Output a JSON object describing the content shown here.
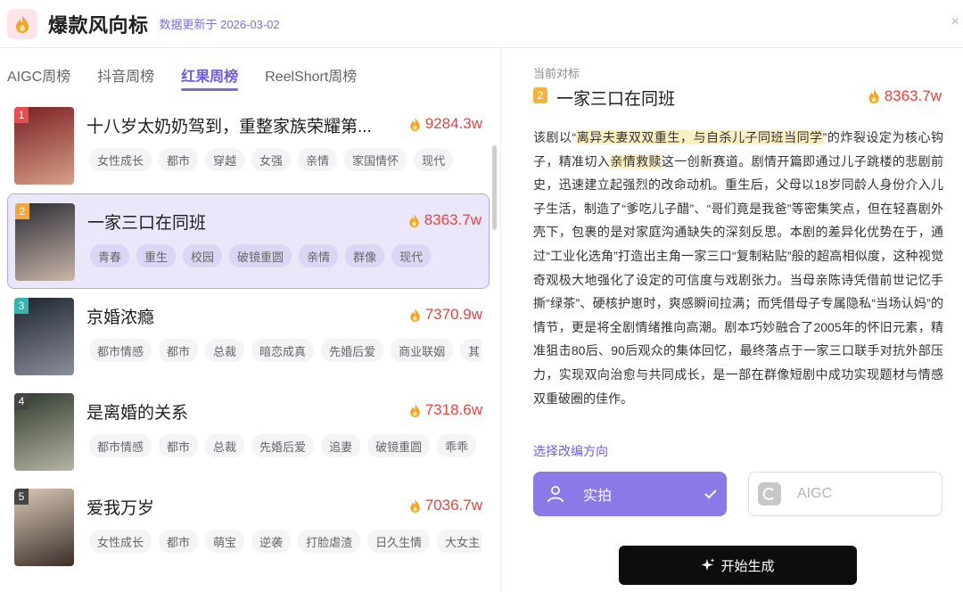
{
  "header": {
    "title": "爆款风向标",
    "update_info": "数据更新于 2026-03-02",
    "logo_icon": "flame-icon"
  },
  "tabs": [
    {
      "label": "AIGC周榜",
      "active": false
    },
    {
      "label": "抖音周榜",
      "active": false
    },
    {
      "label": "红果周榜",
      "active": true
    },
    {
      "label": "ReelShort周榜",
      "active": false
    }
  ],
  "list": [
    {
      "rank": "1",
      "title": "十八岁太奶奶驾到，重整家族荣耀第...",
      "heat": "9284.3w",
      "tags": [
        "女性成长",
        "都市",
        "穿越",
        "女强",
        "亲情",
        "家国情怀",
        "现代"
      ],
      "rank_color": "#e84c4c",
      "poster_colors": [
        "#7a1f22",
        "#d6a08a"
      ],
      "selected": false
    },
    {
      "rank": "2",
      "title": "一家三口在同班",
      "heat": "8363.7w",
      "tags": [
        "青春",
        "重生",
        "校园",
        "破镜重圆",
        "亲情",
        "群像",
        "现代"
      ],
      "rank_color": "#f3a93a",
      "poster_colors": [
        "#2b2b35",
        "#c9b7a8"
      ],
      "selected": true
    },
    {
      "rank": "3",
      "title": "京婚浓瘾",
      "heat": "7370.9w",
      "tags": [
        "都市情感",
        "都市",
        "总裁",
        "暗恋成真",
        "先婚后爱",
        "商业联姻",
        "其"
      ],
      "rank_color": "#35b4b0",
      "poster_colors": [
        "#1d2330",
        "#8b8f9a"
      ],
      "selected": false
    },
    {
      "rank": "4",
      "title": "是离婚的关系",
      "heat": "7318.6w",
      "tags": [
        "都市情感",
        "都市",
        "总裁",
        "先婚后爱",
        "追妻",
        "破镜重圆",
        "乖乖"
      ],
      "rank_color": "#444444",
      "poster_colors": [
        "#2e3a2c",
        "#b6b4a6"
      ],
      "selected": false
    },
    {
      "rank": "5",
      "title": "爱我万岁",
      "heat": "7036.7w",
      "tags": [
        "女性成长",
        "都市",
        "萌宝",
        "逆袭",
        "打脸虐渣",
        "日久生情",
        "大女主"
      ],
      "rank_color": "#444444",
      "poster_colors": [
        "#d9c9b6",
        "#3b2e28"
      ],
      "selected": false
    }
  ],
  "detail": {
    "label": "当前对标",
    "rank": "2",
    "title": "一家三口在同班",
    "heat": "8363.7w",
    "desc_parts": [
      {
        "text": "该剧以“",
        "hl": false
      },
      {
        "text": "离异夫妻双双重生，与自杀儿子同班当同学",
        "hl": true
      },
      {
        "text": "”的炸裂设定为核心钩子，精准切入",
        "hl": false
      },
      {
        "text": "亲情救赎",
        "hl": true
      },
      {
        "text": "这一创新赛道。剧情开篇即通过儿子跳楼的悲剧前史，迅速建立起强烈的改命动机。重生后，父母以18岁同龄人身份介入儿子生活，制造了“爹吃儿子醋”、“哥们竟是我爸”等密集笑点，但在轻喜剧外壳下，包裹的是对家庭沟通缺失的深刻反思。本剧的差异化优势在于，通过“工业化选角”打造出主角一家三口“复制粘贴”般的超高相似度，这种视觉奇观极大地强化了设定的可信度与戏剧张力。当母亲陈诗凭借前世记忆手撕“绿茶”、硬核护崽时，爽感瞬间拉满；而凭借母子专属隐私“当场认妈”的情节，更是将全剧情绪推向高潮。剧本巧妙融合了2005年的怀旧元素，精准狙击80后、90后观众的集体回忆，最终落点于一家三口联手对抗外部压力，实现双向治愈与共同成长，是一部在群像短剧中成功实现题材与情感双重破圈的佳作。",
        "hl": false
      }
    ],
    "direction_label": "选择改编方向",
    "options": [
      {
        "label": "实拍",
        "icon": "person-icon",
        "selected": true
      },
      {
        "label": "AIGC",
        "icon": "aigc-icon",
        "selected": false
      }
    ],
    "generate_label": "开始生成"
  },
  "colors": {
    "accent": "#7a68e6",
    "heat": "#e8433e",
    "selected_bg": "#ebe7fb"
  }
}
